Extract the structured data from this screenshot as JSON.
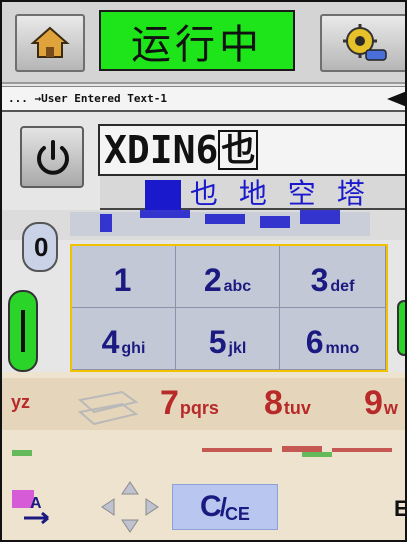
{
  "header": {
    "status": "运行中",
    "home_icon": "home-icon",
    "settings_icon": "settings-gear-icon"
  },
  "message_bar": {
    "text": "... →User Entered Text-1"
  },
  "editor": {
    "text": "XDIN6",
    "cursor_char": "也",
    "candidates": "也 地 空 塔"
  },
  "keypad": {
    "keys": [
      {
        "digit": "1",
        "letters": ""
      },
      {
        "digit": "2",
        "letters": "abc"
      },
      {
        "digit": "3",
        "letters": "def"
      },
      {
        "digit": "4",
        "letters": "ghi"
      },
      {
        "digit": "5",
        "letters": "jkl"
      },
      {
        "digit": "6",
        "letters": "mno"
      }
    ],
    "row3": [
      {
        "digit": "",
        "letters": "yz"
      },
      {
        "digit": "7",
        "letters": "pqrs"
      },
      {
        "digit": "8",
        "letters": "tuv"
      },
      {
        "digit": "9",
        "letters": "w"
      }
    ],
    "clear": {
      "c": "C",
      "ce": "CE"
    },
    "side_left_digit": "0",
    "right_partial": "E"
  },
  "colors": {
    "status_green": "#1ee41a",
    "key_blue": "#1a1a80",
    "key_red": "#b82a2a",
    "pad_border": "#f2c200"
  }
}
